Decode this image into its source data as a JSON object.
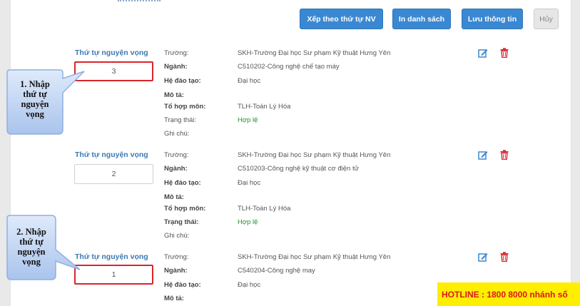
{
  "toolbar": {
    "sort_label": "Xếp theo thứ tự NV",
    "print_label": "In danh sách",
    "save_label": "Lưu thông tin",
    "cancel_label": "Hủy"
  },
  "field_labels": {
    "priority": "Thứ tự nguyện vọng",
    "school": "Trường:",
    "major": "Ngành:",
    "level": "Hệ đào tạo:",
    "description": "Mô tả:",
    "subject_group": "Tổ hợp môn:",
    "status": "Trạng thái:",
    "note": "Ghi chú:"
  },
  "records": [
    {
      "priority": "3",
      "school": "SKH-Trường Đại học Sư phạm Kỹ thuật Hưng Yên",
      "major": "C510202-Công nghệ chế tạo máy",
      "level": "Đại học",
      "description": "",
      "subject_group": "TLH-Toán Lý Hóa",
      "status": "Hợp lệ",
      "note": ""
    },
    {
      "priority": "2",
      "school": "SKH-Trường Đại học Sư phạm Kỹ thuật Hưng Yên",
      "major": "C510203-Công nghệ kỹ thuật cơ điện tử",
      "level": "Đại học",
      "description": "",
      "subject_group": "TLH-Toán Lý Hóa",
      "status": "Hợp lệ",
      "note": ""
    },
    {
      "priority": "1",
      "school": "SKH-Trường Đại học Sư phạm Kỹ thuật Hưng Yên",
      "major": "C540204-Công nghệ may",
      "level": "Đại học",
      "description": ""
    }
  ],
  "callouts": [
    {
      "lines": [
        "1. Nhập",
        "thứ tự",
        "nguyện",
        "vọng"
      ]
    },
    {
      "lines": [
        "2. Nhập",
        "thứ tự",
        "nguyện",
        "vọng"
      ]
    }
  ],
  "hotline": "HOTLINE : 1800 8000 nhánh số",
  "colors": {
    "primary": "#3a88d2",
    "label_blue": "#3c78b5",
    "valid_green": "#1f8f2f",
    "highlight_red": "#d8262b",
    "hotline_bg": "#ffee00",
    "hotline_text": "#d81818"
  },
  "icons": [
    "edit-icon",
    "trash-icon"
  ]
}
